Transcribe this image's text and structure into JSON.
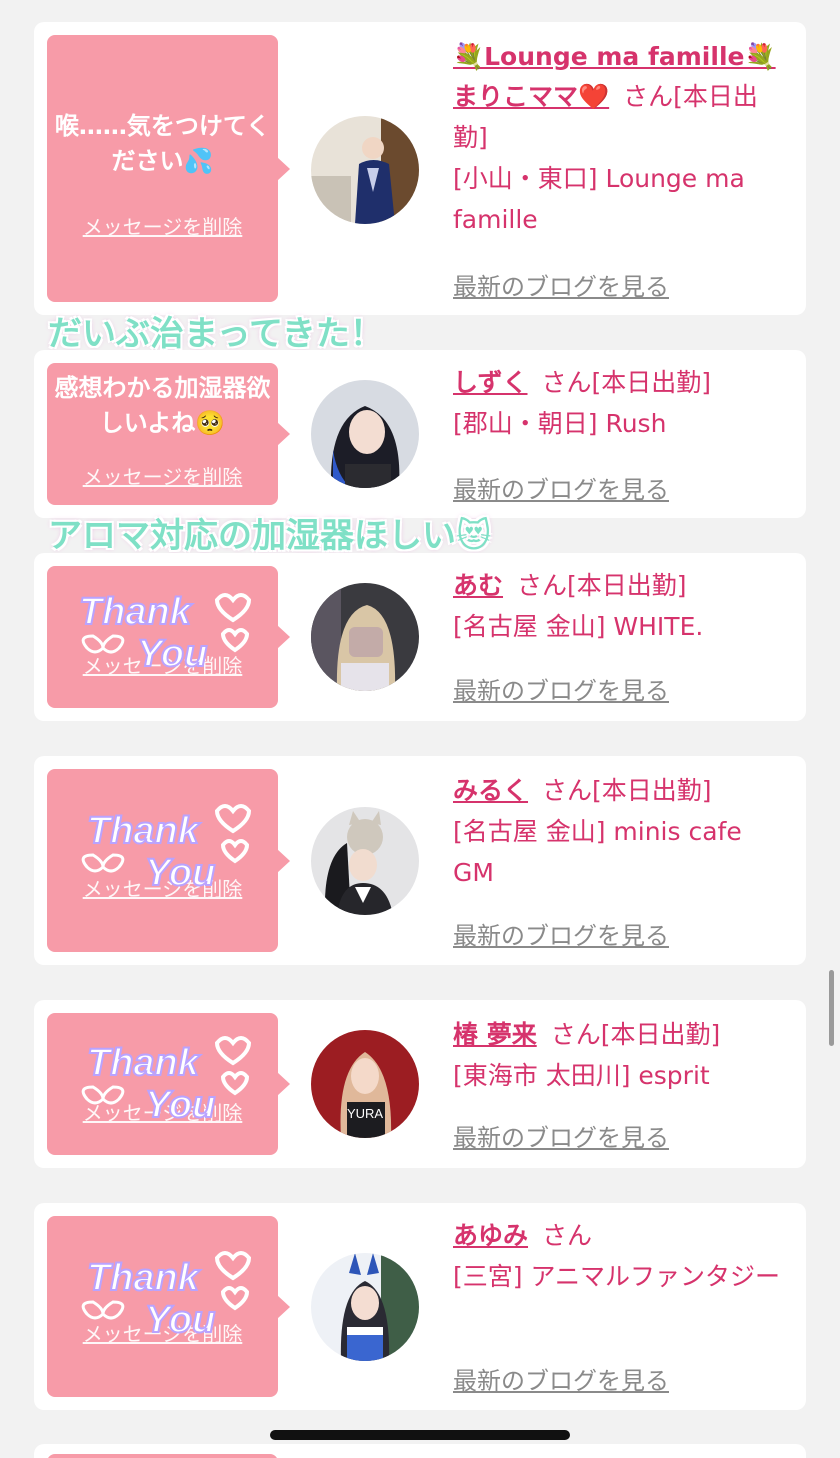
{
  "colors": {
    "page_bg": "#f2f2f2",
    "bubble": "#f79ba8",
    "name_text": "#d6336c",
    "blog_link": "#8a8a8a",
    "overlay_text": "#7fe0c6"
  },
  "delete_label": "メッセージを削除",
  "blog_label": "最新のブログを見る",
  "overlays": [
    "だいぶ治まってきた！",
    "アロマ対応の加湿器ほしい😻"
  ],
  "sticker_text": [
    "Thank",
    "You"
  ],
  "cards": [
    {
      "pre_title": "💐Lounge ma famille💐",
      "message": "喉……気をつけてください💦",
      "name": "まりこママ❤️",
      "suffix": "さん[本日出勤]",
      "shop": "[小山・東口] Lounge ma famille",
      "avatar_icon": "kimono-portrait-avatar"
    },
    {
      "message": "感想わかる加湿器欲しいよね🥺",
      "name": "しずく",
      "suffix": "さん[本日出勤]",
      "shop": "[郡山・朝日] Rush",
      "avatar_icon": "girl-portrait-avatar"
    },
    {
      "name": "あむ",
      "suffix": "さん[本日出勤]",
      "shop": "[名古屋 金山] WHITE.",
      "avatar_icon": "blurred-portrait-avatar"
    },
    {
      "name": "みるく",
      "suffix": "さん[本日出勤]",
      "shop": "[名古屋 金山] minis cafe GM",
      "avatar_icon": "cat-mask-portrait-avatar"
    },
    {
      "name": "椿 夢来",
      "suffix": "さん[本日出勤]",
      "shop": "[東海市 太田川] esprit",
      "avatar_icon": "birthday-portrait-avatar",
      "avatar_text": "YURA"
    },
    {
      "name": "あゆみ",
      "suffix": "さん",
      "shop": "[三宮] アニマルファンタジー",
      "avatar_icon": "bunny-costume-portrait-avatar"
    }
  ]
}
